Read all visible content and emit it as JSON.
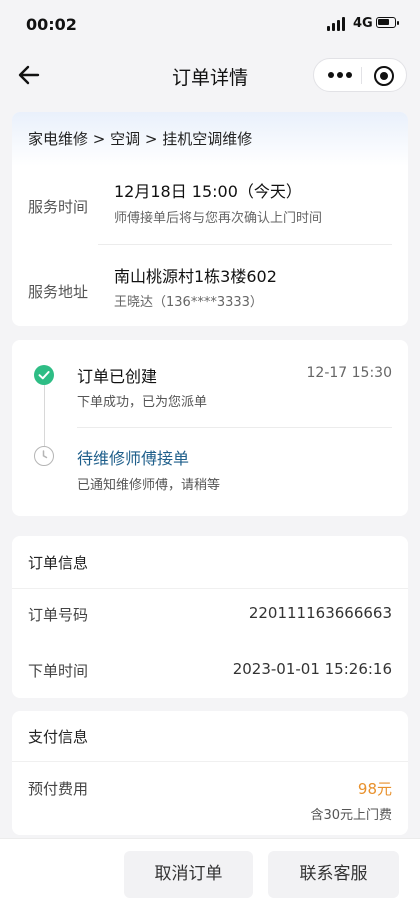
{
  "status_bar": {
    "time": "00:02",
    "network": "4G"
  },
  "nav": {
    "title": "订单详情",
    "back_icon": "arrow-left-icon",
    "more_icon": "more-dots-icon",
    "target_icon": "target-icon"
  },
  "service": {
    "breadcrumb": "家电维修 > 空调 > 挂机空调维修",
    "time_label": "服务时间",
    "time_value": "12月18日  15:00（今天）",
    "time_note": "师傅接单后将与您再次确认上门时间",
    "address_label": "服务地址",
    "address_value": "南山桃源村1栋3楼602",
    "contact": "王晓达（136****3333）"
  },
  "timeline": [
    {
      "title": "订单已创建",
      "desc": "下单成功，已为您派单",
      "time": "12-17 15:30",
      "status": "done",
      "icon": "check-circle-icon"
    },
    {
      "title": "待维修师傅接单",
      "desc": "已通知维修师傅，请稍等",
      "time": "",
      "status": "pending",
      "icon": "clock-icon"
    }
  ],
  "order_info": {
    "title": "订单信息",
    "number_label": "订单号码",
    "number_value": "220111163666663",
    "created_label": "下单时间",
    "created_value": "2023-01-01 15:26:16"
  },
  "payment": {
    "title": "支付信息",
    "prepaid_label": "预付费用",
    "prepaid_value": "98元",
    "prepaid_note": "含30元上门费"
  },
  "actions": {
    "cancel": "取消订单",
    "contact": "联系客服"
  },
  "colors": {
    "accent_green": "#2ebd85",
    "pending_blue": "#1f5f8b",
    "price_orange": "#e8912d"
  }
}
